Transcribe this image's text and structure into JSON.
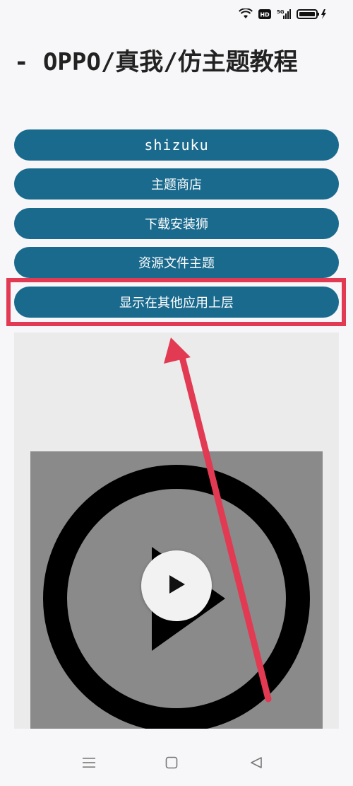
{
  "status_bar": {
    "icons": [
      "wifi-icon",
      "hd-icon",
      "signal-5g-icon",
      "battery-charging-icon"
    ],
    "hd_label": "HD",
    "network_label": "5G"
  },
  "title": "- OPPO/真我/仿主题教程",
  "buttons": [
    {
      "label": "shizuku"
    },
    {
      "label": "主题商店"
    },
    {
      "label": "下载安装狮"
    },
    {
      "label": "资源文件主题"
    },
    {
      "label": "显示在其他应用上层",
      "highlighted": true
    }
  ],
  "video": {
    "play_icon": "play-icon"
  },
  "annotation": {
    "color": "#e23a52",
    "arrow_icon": "annotation-arrow"
  },
  "nav_bar": {
    "icons": [
      "menu-icon",
      "home-icon",
      "back-icon"
    ]
  },
  "colors": {
    "button_bg": "#1a6a8e",
    "highlight": "#e23a52"
  }
}
